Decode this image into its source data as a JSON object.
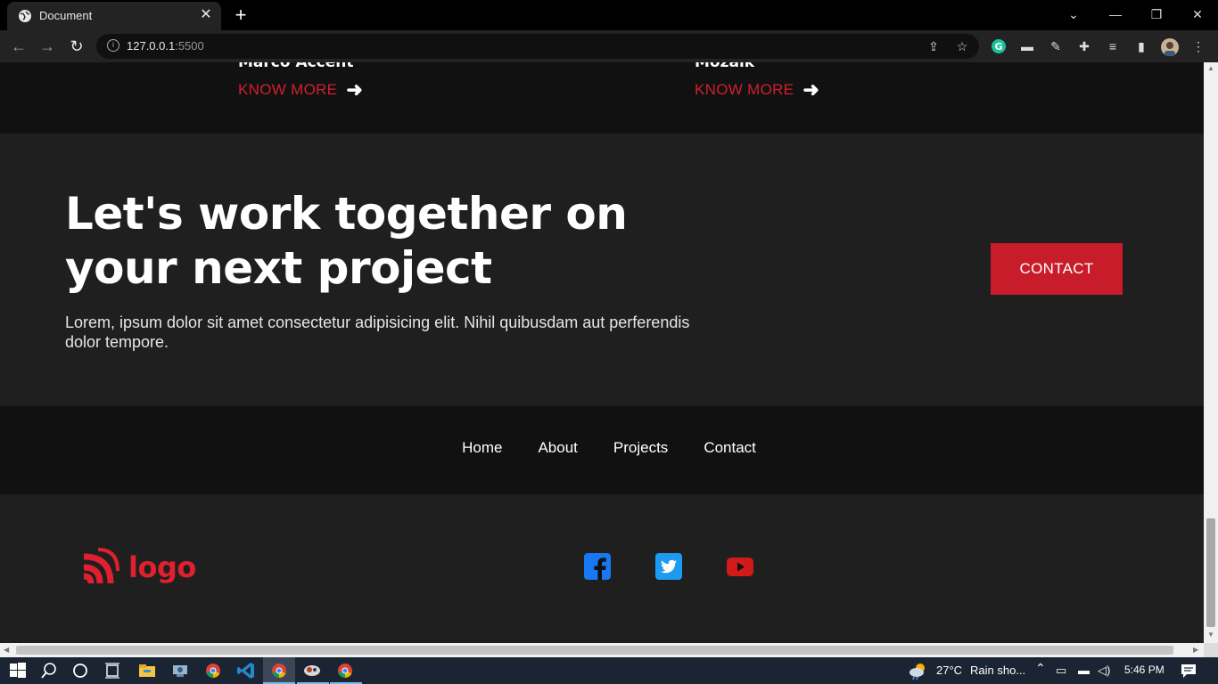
{
  "browser": {
    "tab_title": "Document",
    "close_glyph": "✕",
    "new_tab_glyph": "+",
    "url_host": "127.0.0.1",
    "url_port": ":5500",
    "info_glyph": "i"
  },
  "projects": [
    {
      "title": "Marco Accent",
      "link": "KNOW MORE",
      "arrow": "➜"
    },
    {
      "title": "Mozaik",
      "link": "KNOW MORE",
      "arrow": "➜"
    }
  ],
  "cta": {
    "heading": "Let's work together on your next project",
    "text": "Lorem, ipsum dolor sit amet consectetur adipisicing elit. Nihil quibusdam aut perferendis dolor tempore.",
    "button": "CONTACT"
  },
  "footer_nav": [
    "Home",
    "About",
    "Projects",
    "Contact"
  ],
  "footer": {
    "logo_text": "logo",
    "social_icons": [
      "facebook-icon",
      "twitter-icon",
      "youtube-icon"
    ]
  },
  "taskbar": {
    "weather": "27°C",
    "weather_text": "Rain sho...",
    "time": "5:46 PM"
  },
  "colors": {
    "accent": "#d21f2c",
    "dark_band": "#111111",
    "section_bg": "#1f1f1f",
    "facebook": "#1877f2",
    "twitter": "#1d9bf0",
    "youtube": "#d11a1a"
  }
}
